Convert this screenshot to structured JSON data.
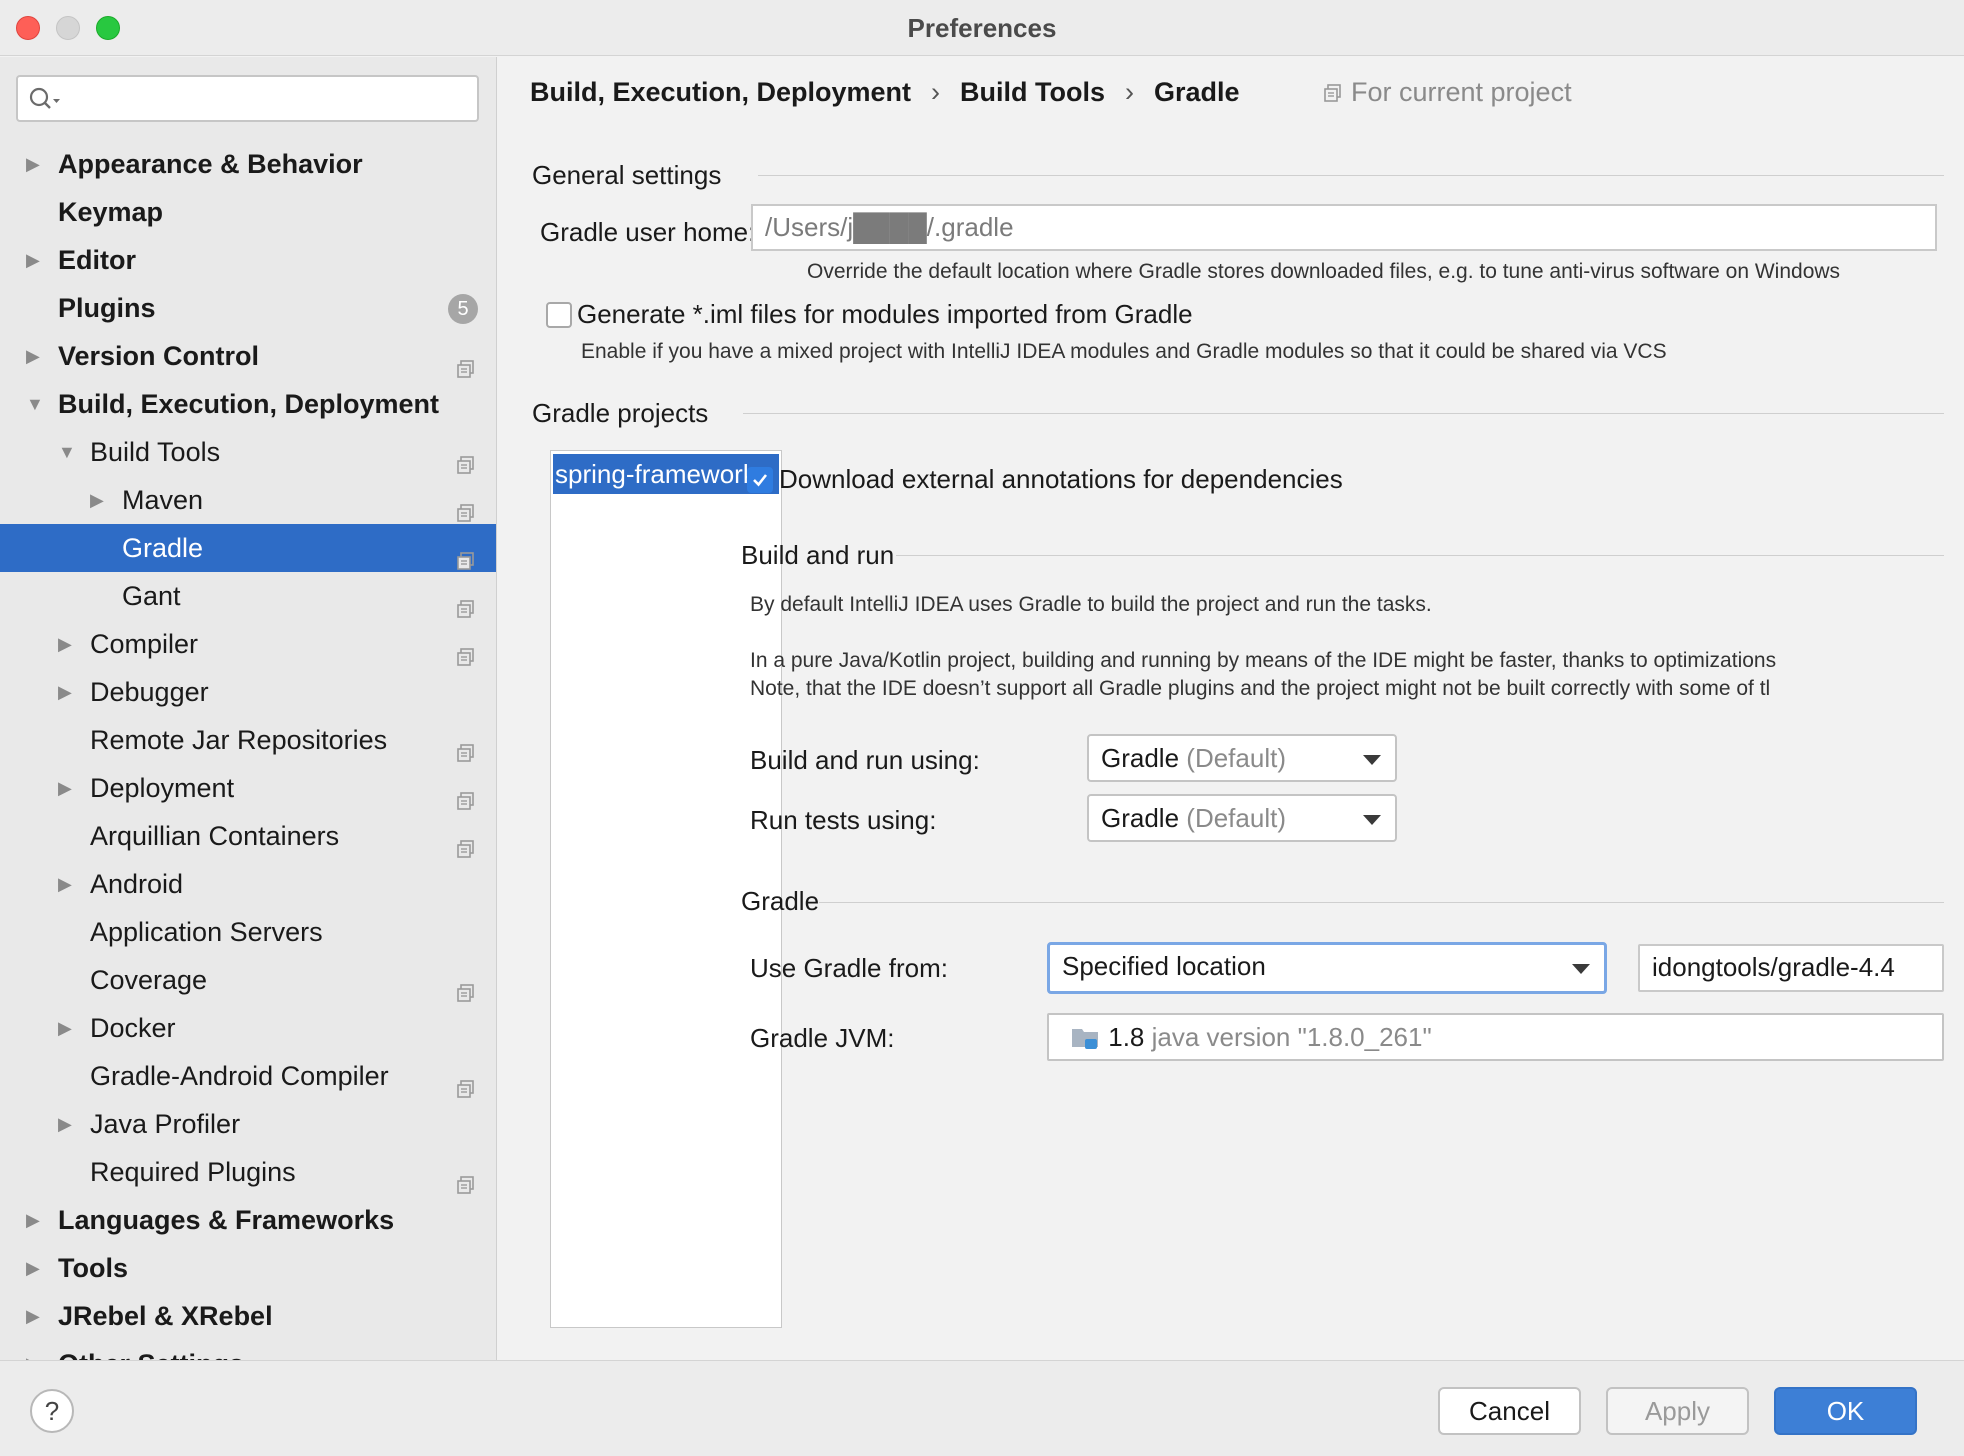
{
  "window": {
    "title": "Preferences"
  },
  "sidebar": {
    "search": {
      "value": "",
      "placeholder": ""
    },
    "items": [
      {
        "label": "Appearance & Behavior",
        "expanded": false
      },
      {
        "label": "Keymap"
      },
      {
        "label": "Editor",
        "expanded": false
      },
      {
        "label": "Plugins",
        "badge": "5"
      },
      {
        "label": "Version Control",
        "expanded": false
      },
      {
        "label": "Build, Execution, Deployment",
        "expanded": true
      },
      {
        "label": "Build Tools",
        "expanded": true
      },
      {
        "label": "Maven",
        "expanded": false
      },
      {
        "label": "Gradle",
        "selected": true
      },
      {
        "label": "Gant"
      },
      {
        "label": "Compiler",
        "expanded": false
      },
      {
        "label": "Debugger",
        "expanded": false
      },
      {
        "label": "Remote Jar Repositories"
      },
      {
        "label": "Deployment",
        "expanded": false
      },
      {
        "label": "Arquillian Containers"
      },
      {
        "label": "Android",
        "expanded": false
      },
      {
        "label": "Application Servers"
      },
      {
        "label": "Coverage"
      },
      {
        "label": "Docker",
        "expanded": false
      },
      {
        "label": "Gradle-Android Compiler"
      },
      {
        "label": "Java Profiler",
        "expanded": false
      },
      {
        "label": "Required Plugins"
      },
      {
        "label": "Languages & Frameworks",
        "expanded": false
      },
      {
        "label": "Tools",
        "expanded": false
      },
      {
        "label": "JRebel & XRebel",
        "expanded": false
      },
      {
        "label": "Other Settings",
        "expanded": false
      }
    ]
  },
  "breadcrumb": [
    "Build, Execution, Deployment",
    "Build Tools",
    "Gradle"
  ],
  "scope_label": "For current project",
  "general": {
    "title": "General settings",
    "user_home_label": "Gradle user home:",
    "user_home_value": "/Users/j████/.gradle",
    "user_home_hint": "Override the default location where Gradle stores downloaded files, e.g. to tune anti-virus software on Windows",
    "iml_checkbox_label": "Generate *.iml files for modules imported from Gradle",
    "iml_checked": false,
    "iml_hint": "Enable if you have a mixed project with IntelliJ IDEA modules and Gradle modules so that it could be shared via VCS"
  },
  "projects": {
    "title": "Gradle projects",
    "list": [
      "spring-framework"
    ],
    "download_annotations_label": "Download external annotations for dependencies",
    "download_annotations_checked": true
  },
  "build_run": {
    "title": "Build and run",
    "desc1": "By default IntelliJ IDEA uses Gradle to build the project and run the tasks.",
    "desc2": "In a pure Java/Kotlin project, building and running by means of the IDE might be faster, thanks to optimizations",
    "desc3": "Note, that the IDE doesn’t support all Gradle plugins and the project might not be built correctly with some of tl",
    "using_label": "Build and run using:",
    "using_value": "Gradle",
    "using_suffix": "(Default)",
    "tests_label": "Run tests using:",
    "tests_value": "Gradle",
    "tests_suffix": "(Default)"
  },
  "gradle": {
    "title": "Gradle",
    "from_label": "Use Gradle from:",
    "from_value": "Specified location",
    "location_value": "idongtools/gradle-4.4",
    "jvm_label": "Gradle JVM:",
    "jvm_version": "1.8",
    "jvm_detail": "java version \"1.8.0_261\""
  },
  "footer": {
    "help_label": "?",
    "cancel_label": "Cancel",
    "apply_label": "Apply",
    "ok_label": "OK"
  },
  "colors": {
    "selection": "#2e6cc6",
    "primary_button": "#3d7fd6",
    "close": "#fe5f57",
    "maximize": "#28c840"
  }
}
